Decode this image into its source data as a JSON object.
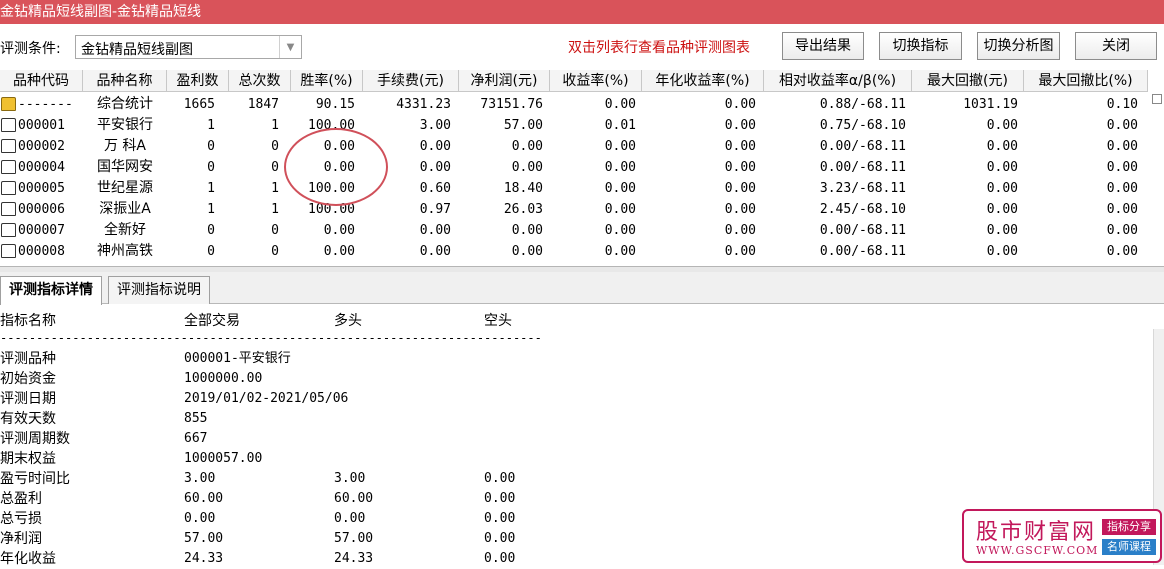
{
  "window": {
    "title": "金钻精品短线副图-金钻精品短线"
  },
  "toolbar": {
    "condition_label": "评测条件:",
    "condition_value": "金钻精品短线副图",
    "hint": "双击列表行查看品种评测图表",
    "export_label": "导出结果",
    "switch_indicator_label": "切换指标",
    "switch_chart_label": "切换分析图",
    "close_label": "关闭"
  },
  "grid": {
    "headers": [
      "品种代码",
      "品种名称",
      "盈利数",
      "总次数",
      "胜率(%)",
      "手续费(元)",
      "净利润(元)",
      "收益率(%)",
      "年化收益率(%)",
      "相对收益率α/β(%)",
      "最大回撤(元)",
      "最大回撤比(%)"
    ],
    "rows": [
      [
        "-------",
        "综合统计",
        "1665",
        "1847",
        "90.15",
        "4331.23",
        "73151.76",
        "0.00",
        "0.00",
        "0.88/-68.11",
        "1031.19",
        "0.10"
      ],
      [
        "000001",
        "平安银行",
        "1",
        "1",
        "100.00",
        "3.00",
        "57.00",
        "0.01",
        "0.00",
        "0.75/-68.10",
        "0.00",
        "0.00"
      ],
      [
        "000002",
        "万 科A",
        "0",
        "0",
        "0.00",
        "0.00",
        "0.00",
        "0.00",
        "0.00",
        "0.00/-68.11",
        "0.00",
        "0.00"
      ],
      [
        "000004",
        "国华网安",
        "0",
        "0",
        "0.00",
        "0.00",
        "0.00",
        "0.00",
        "0.00",
        "0.00/-68.11",
        "0.00",
        "0.00"
      ],
      [
        "000005",
        "世纪星源",
        "1",
        "1",
        "100.00",
        "0.60",
        "18.40",
        "0.00",
        "0.00",
        "3.23/-68.11",
        "0.00",
        "0.00"
      ],
      [
        "000006",
        "深振业A",
        "1",
        "1",
        "100.00",
        "0.97",
        "26.03",
        "0.00",
        "0.00",
        "2.45/-68.10",
        "0.00",
        "0.00"
      ],
      [
        "000007",
        "全新好",
        "0",
        "0",
        "0.00",
        "0.00",
        "0.00",
        "0.00",
        "0.00",
        "0.00/-68.11",
        "0.00",
        "0.00"
      ],
      [
        "000008",
        "神州高铁",
        "0",
        "0",
        "0.00",
        "0.00",
        "0.00",
        "0.00",
        "0.00",
        "0.00/-68.11",
        "0.00",
        "0.00"
      ]
    ]
  },
  "tabs": [
    {
      "label": "评测指标详情",
      "active": true
    },
    {
      "label": "评测指标说明",
      "active": false
    }
  ],
  "detail": {
    "headers": [
      "指标名称",
      "全部交易",
      "多头",
      "空头"
    ],
    "dashes": "----------------------------------------------------------------------------",
    "rows": [
      [
        "评测品种",
        "000001-平安银行",
        "",
        ""
      ],
      [
        "初始资金",
        "1000000.00",
        "",
        ""
      ],
      [
        "评测日期",
        "2019/01/02-2021/05/06",
        "",
        ""
      ],
      [
        "有效天数",
        "855",
        "",
        ""
      ],
      [
        "评测周期数",
        "667",
        "",
        ""
      ],
      [
        "期末权益",
        "1000057.00",
        "",
        ""
      ],
      [
        "盈亏时间比",
        "3.00",
        "3.00",
        "0.00"
      ],
      [
        "总盈利",
        "60.00",
        "60.00",
        "0.00"
      ],
      [
        "总亏损",
        "0.00",
        "0.00",
        "0.00"
      ],
      [
        "净利润",
        "57.00",
        "57.00",
        "0.00"
      ],
      [
        "年化收益",
        "24.33",
        "24.33",
        "0.00"
      ]
    ]
  },
  "watermark": {
    "name": "股市财富网",
    "url": "WWW.GSCFW.COM",
    "tag1": "指标分享",
    "tag2": "名师课程"
  },
  "colors": {
    "title_bar": "#d9535a",
    "hint": "#cc1111",
    "highlight_circle": "#d0505a",
    "watermark": "#c2185b"
  }
}
